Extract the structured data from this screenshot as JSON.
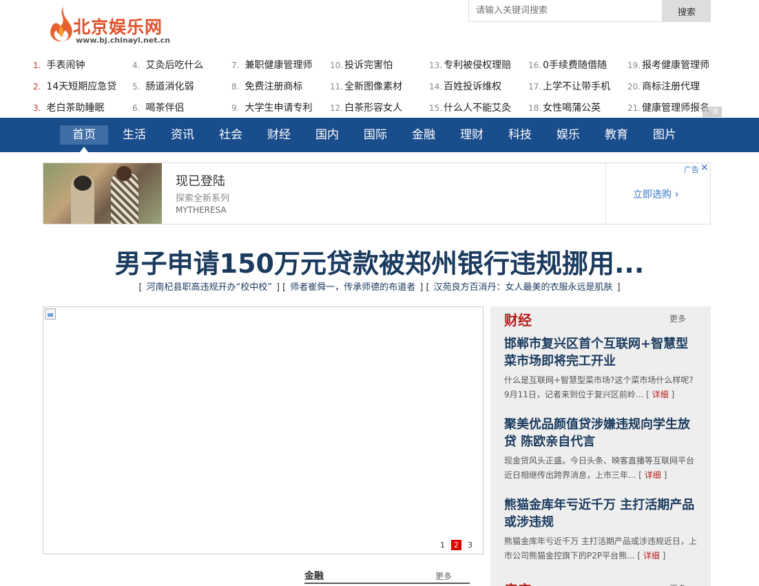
{
  "logo": {
    "name": "北京娱乐网",
    "url": "www.bj.chinayl.net.cn"
  },
  "search": {
    "placeholder": "请输入关键词搜索",
    "button": "搜索"
  },
  "hot_keywords": [
    {
      "num": "1.",
      "text": "手表闹钟"
    },
    {
      "num": "2.",
      "text": "14天短期应急贷"
    },
    {
      "num": "3.",
      "text": "老白茶助睡眠"
    },
    {
      "num": "4.",
      "text": "艾灸后吃什么"
    },
    {
      "num": "5.",
      "text": "肠道消化弱"
    },
    {
      "num": "6.",
      "text": "喝茶伴侣"
    },
    {
      "num": "7.",
      "text": "兼职健康管理师"
    },
    {
      "num": "8.",
      "text": "免费注册商标"
    },
    {
      "num": "9.",
      "text": "大学生申请专利"
    },
    {
      "num": "10.",
      "text": "投诉完害怕"
    },
    {
      "num": "11.",
      "text": "全新图像素材"
    },
    {
      "num": "12.",
      "text": "白茶形容女人"
    },
    {
      "num": "13.",
      "text": "专利被侵权理赔"
    },
    {
      "num": "14.",
      "text": "百姓投诉维权"
    },
    {
      "num": "15.",
      "text": "什么人不能艾灸"
    },
    {
      "num": "16.",
      "text": "0手续费随借随"
    },
    {
      "num": "17.",
      "text": "上学不让带手机"
    },
    {
      "num": "18.",
      "text": "女性喝蒲公英"
    },
    {
      "num": "19.",
      "text": "报考健康管理师"
    },
    {
      "num": "20.",
      "text": "商标注册代理"
    },
    {
      "num": "21.",
      "text": "健康管理师报名"
    }
  ],
  "ad_mark": "广告",
  "nav": [
    "首页",
    "生活",
    "资讯",
    "社会",
    "财经",
    "国内",
    "国际",
    "金融",
    "理财",
    "科技",
    "娱乐",
    "教育",
    "图片"
  ],
  "ad": {
    "title": "现已登陆",
    "subtitle": "探索全新系列",
    "brand": "MYTHERESA",
    "cta": "立即选购",
    "label": "广告"
  },
  "headline": "男子申请150万元贷款被郑州银行违规挪用...",
  "sub_links": [
    "河南杞县职高违规开办“校中校”",
    "师者崔舜一，传承师德的布道者",
    "汉苑良方百消丹：女人最美的衣服永远是肌肤"
  ],
  "slider_dots": [
    "1",
    "2",
    "3"
  ],
  "finance_section": {
    "title": "金融",
    "more": "更多"
  },
  "side": {
    "title": "财经",
    "more": "更多",
    "news": [
      {
        "title": "邯郸市复兴区首个互联网+智慧型菜市场即将完工开业",
        "desc": "什么是互联网+智慧型菜市场?这个菜市场什么样呢?9月11日，记者来到位于复兴区前岭...",
        "detail": "详细"
      },
      {
        "title": "聚美优品颜值贷涉嫌违规向学生放贷 陈欧亲自代言",
        "desc": "现金贷风头正盛。今日头条、映客直播等互联网平台近日相继传出跨界消息，上市三年...",
        "detail": "详细"
      },
      {
        "title": "熊猫金库年亏近千万 主打活期产品或涉违规",
        "desc": "熊猫金库年亏近千万 主打活期产品或涉违规近日，上市公司熊猫金控旗下的P2P平台熊...",
        "detail": "详细"
      }
    ],
    "next_title": "房产",
    "next_more": "更多"
  }
}
